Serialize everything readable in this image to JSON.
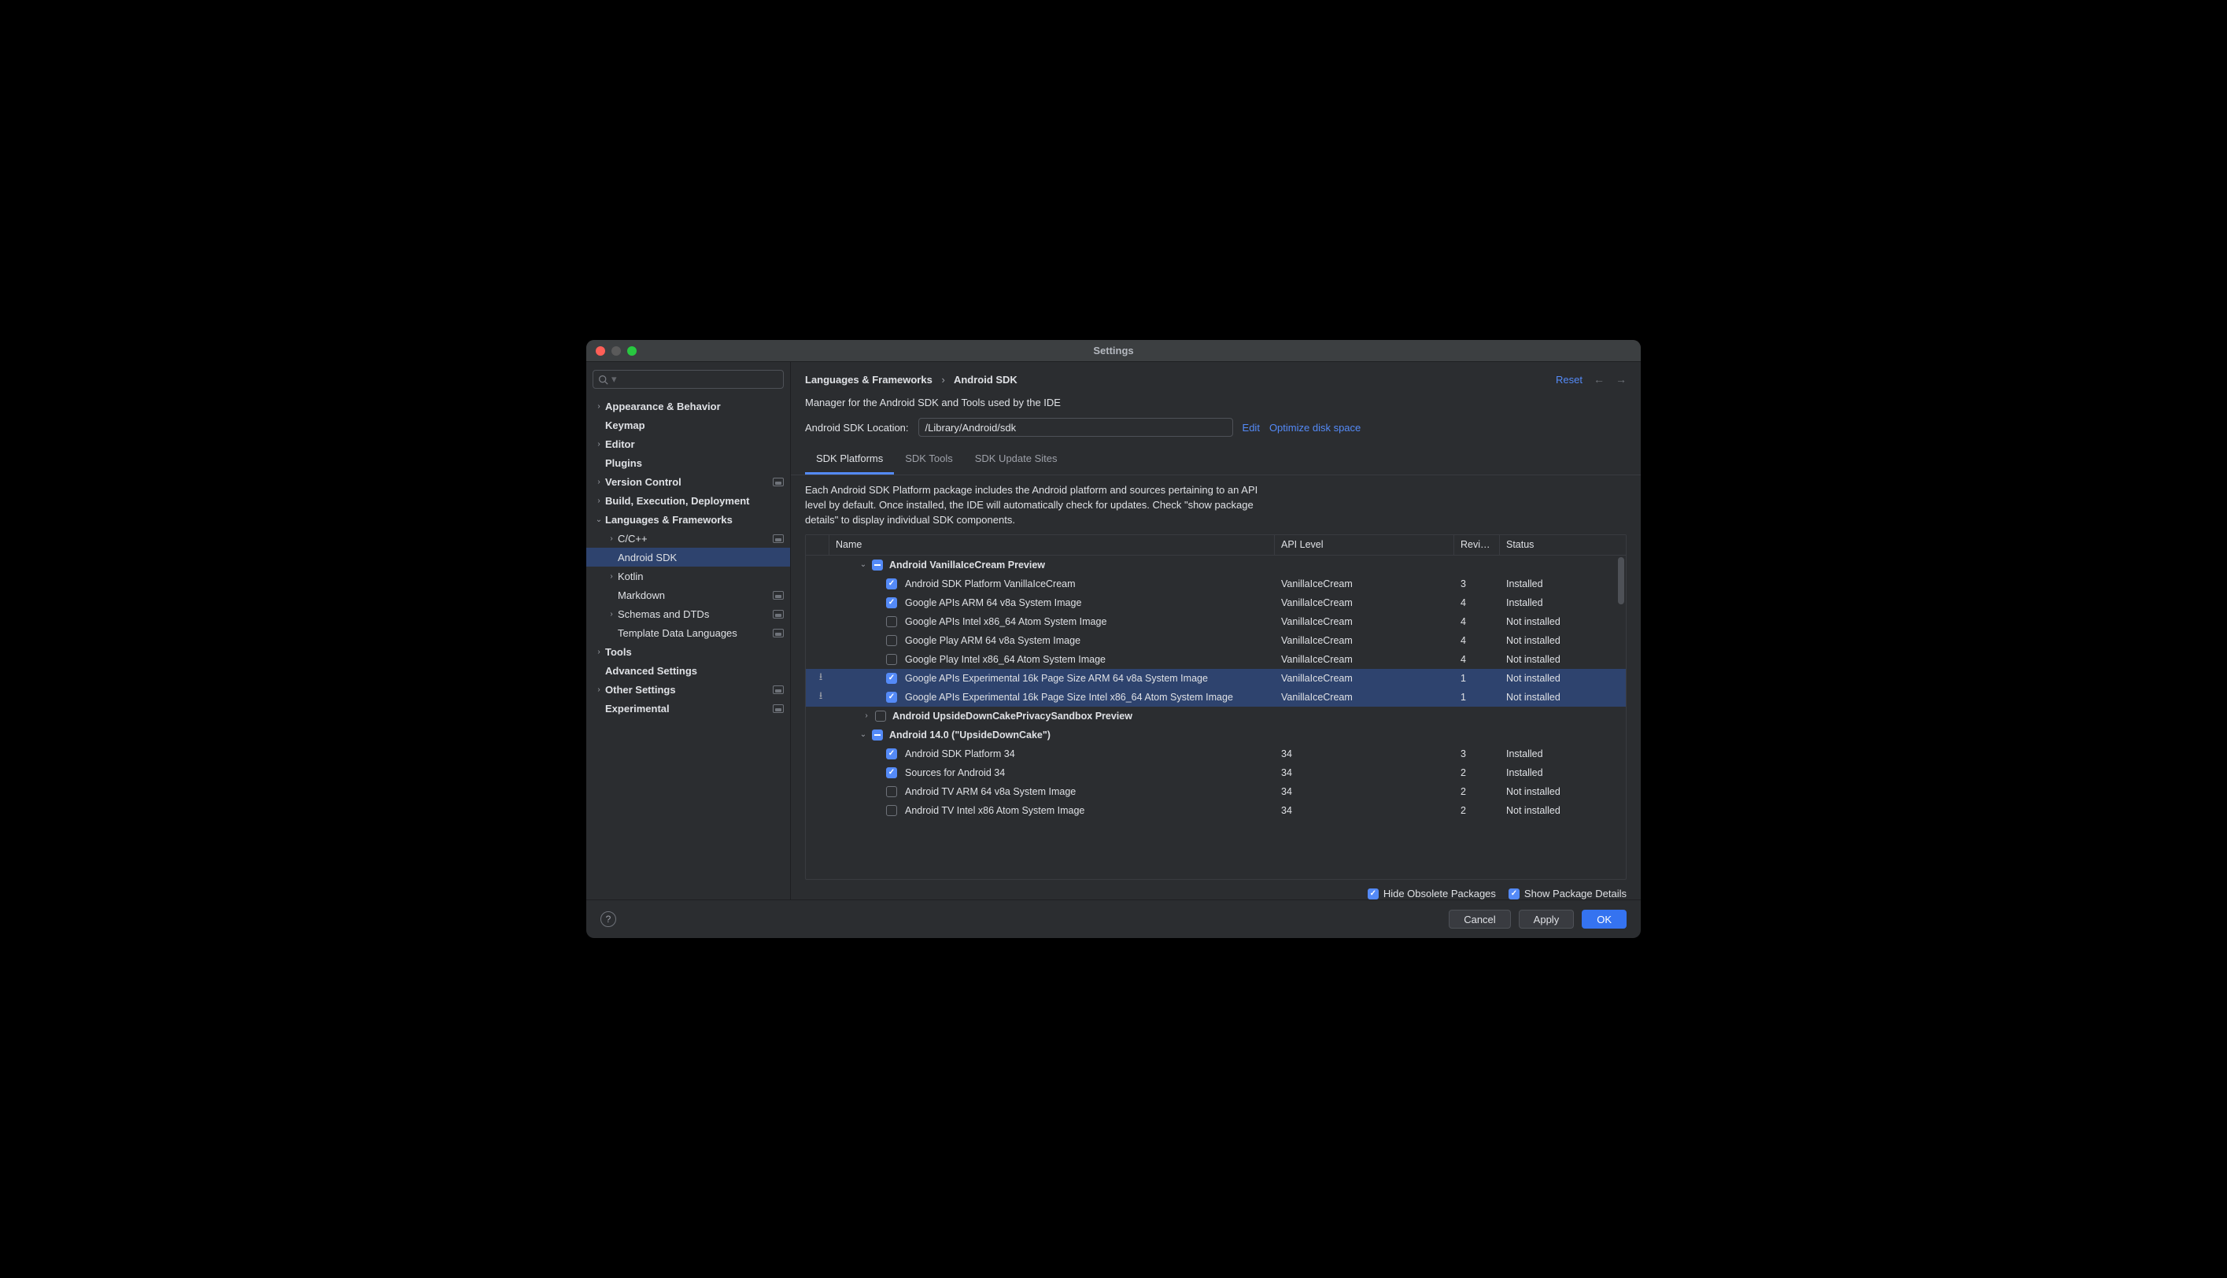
{
  "window": {
    "title": "Settings"
  },
  "breadcrumb": {
    "parent": "Languages & Frameworks",
    "current": "Android SDK",
    "reset": "Reset"
  },
  "subtitle": "Manager for the Android SDK and Tools used by the IDE",
  "location": {
    "label": "Android SDK Location:",
    "value": "/Library/Android/sdk",
    "edit": "Edit",
    "optimize": "Optimize disk space"
  },
  "tabs": {
    "platforms": "SDK Platforms",
    "tools": "SDK Tools",
    "update": "SDK Update Sites"
  },
  "desc": "Each Android SDK Platform package includes the Android platform and sources pertaining to an API level by default. Once installed, the IDE will automatically check for updates. Check \"show package details\" to display individual SDK components.",
  "columns": {
    "name": "Name",
    "api": "API Level",
    "rev": "Revi…",
    "status": "Status"
  },
  "options": {
    "hide": "Hide Obsolete Packages",
    "details": "Show Package Details"
  },
  "buttons": {
    "cancel": "Cancel",
    "apply": "Apply",
    "ok": "OK"
  },
  "sidebar": [
    {
      "label": "Appearance & Behavior",
      "depth": 0,
      "chev": "›",
      "bold": true
    },
    {
      "label": "Keymap",
      "depth": 0,
      "bold": true
    },
    {
      "label": "Editor",
      "depth": 0,
      "chev": "›",
      "bold": true
    },
    {
      "label": "Plugins",
      "depth": 0,
      "bold": true
    },
    {
      "label": "Version Control",
      "depth": 0,
      "chev": "›",
      "bold": true,
      "badge": true
    },
    {
      "label": "Build, Execution, Deployment",
      "depth": 0,
      "chev": "›",
      "bold": true
    },
    {
      "label": "Languages & Frameworks",
      "depth": 0,
      "chev": "⌄",
      "bold": true
    },
    {
      "label": "C/C++",
      "depth": 1,
      "chev": "›",
      "badge": true
    },
    {
      "label": "Android SDK",
      "depth": 1,
      "sel": true
    },
    {
      "label": "Kotlin",
      "depth": 1,
      "chev": "›"
    },
    {
      "label": "Markdown",
      "depth": 1,
      "badge": true
    },
    {
      "label": "Schemas and DTDs",
      "depth": 1,
      "chev": "›",
      "badge": true
    },
    {
      "label": "Template Data Languages",
      "depth": 1,
      "badge": true
    },
    {
      "label": "Tools",
      "depth": 0,
      "chev": "›",
      "bold": true
    },
    {
      "label": "Advanced Settings",
      "depth": 0,
      "bold": true
    },
    {
      "label": "Other Settings",
      "depth": 0,
      "chev": "›",
      "bold": true,
      "badge": true
    },
    {
      "label": "Experimental",
      "depth": 0,
      "bold": true,
      "badge": true
    }
  ],
  "rows": [
    {
      "type": "group",
      "exp": "⌄",
      "cb": "mixed",
      "name": "Android VanillaIceCream Preview"
    },
    {
      "type": "item",
      "cb": "checked",
      "name": "Android SDK Platform VanillaIceCream",
      "api": "VanillaIceCream",
      "rev": "3",
      "status": "Installed"
    },
    {
      "type": "item",
      "cb": "checked",
      "name": "Google APIs ARM 64 v8a System Image",
      "api": "VanillaIceCream",
      "rev": "4",
      "status": "Installed"
    },
    {
      "type": "item",
      "cb": "",
      "name": "Google APIs Intel x86_64 Atom System Image",
      "api": "VanillaIceCream",
      "rev": "4",
      "status": "Not installed"
    },
    {
      "type": "item",
      "cb": "",
      "name": "Google Play ARM 64 v8a System Image",
      "api": "VanillaIceCream",
      "rev": "4",
      "status": "Not installed"
    },
    {
      "type": "item",
      "cb": "",
      "name": "Google Play Intel x86_64 Atom System Image",
      "api": "VanillaIceCream",
      "rev": "4",
      "status": "Not installed"
    },
    {
      "type": "item",
      "cb": "checked",
      "name": "Google APIs Experimental 16k Page Size ARM 64 v8a System Image",
      "api": "VanillaIceCream",
      "rev": "1",
      "status": "Not installed",
      "sel": true,
      "dl": true
    },
    {
      "type": "item",
      "cb": "checked",
      "name": "Google APIs Experimental 16k Page Size Intel x86_64 Atom System Image",
      "api": "VanillaIceCream",
      "rev": "1",
      "status": "Not installed",
      "sel": true,
      "dl": true
    },
    {
      "type": "group",
      "exp": "›",
      "cb": "",
      "name": "Android UpsideDownCakePrivacySandbox Preview",
      "ind": 1
    },
    {
      "type": "group",
      "exp": "⌄",
      "cb": "mixed",
      "name": "Android 14.0 (\"UpsideDownCake\")"
    },
    {
      "type": "item",
      "cb": "checked",
      "name": "Android SDK Platform 34",
      "api": "34",
      "rev": "3",
      "status": "Installed"
    },
    {
      "type": "item",
      "cb": "checked",
      "name": "Sources for Android 34",
      "api": "34",
      "rev": "2",
      "status": "Installed"
    },
    {
      "type": "item",
      "cb": "",
      "name": "Android TV ARM 64 v8a System Image",
      "api": "34",
      "rev": "2",
      "status": "Not installed"
    },
    {
      "type": "item",
      "cb": "",
      "name": "Android TV Intel x86 Atom System Image",
      "api": "34",
      "rev": "2",
      "status": "Not installed"
    }
  ]
}
